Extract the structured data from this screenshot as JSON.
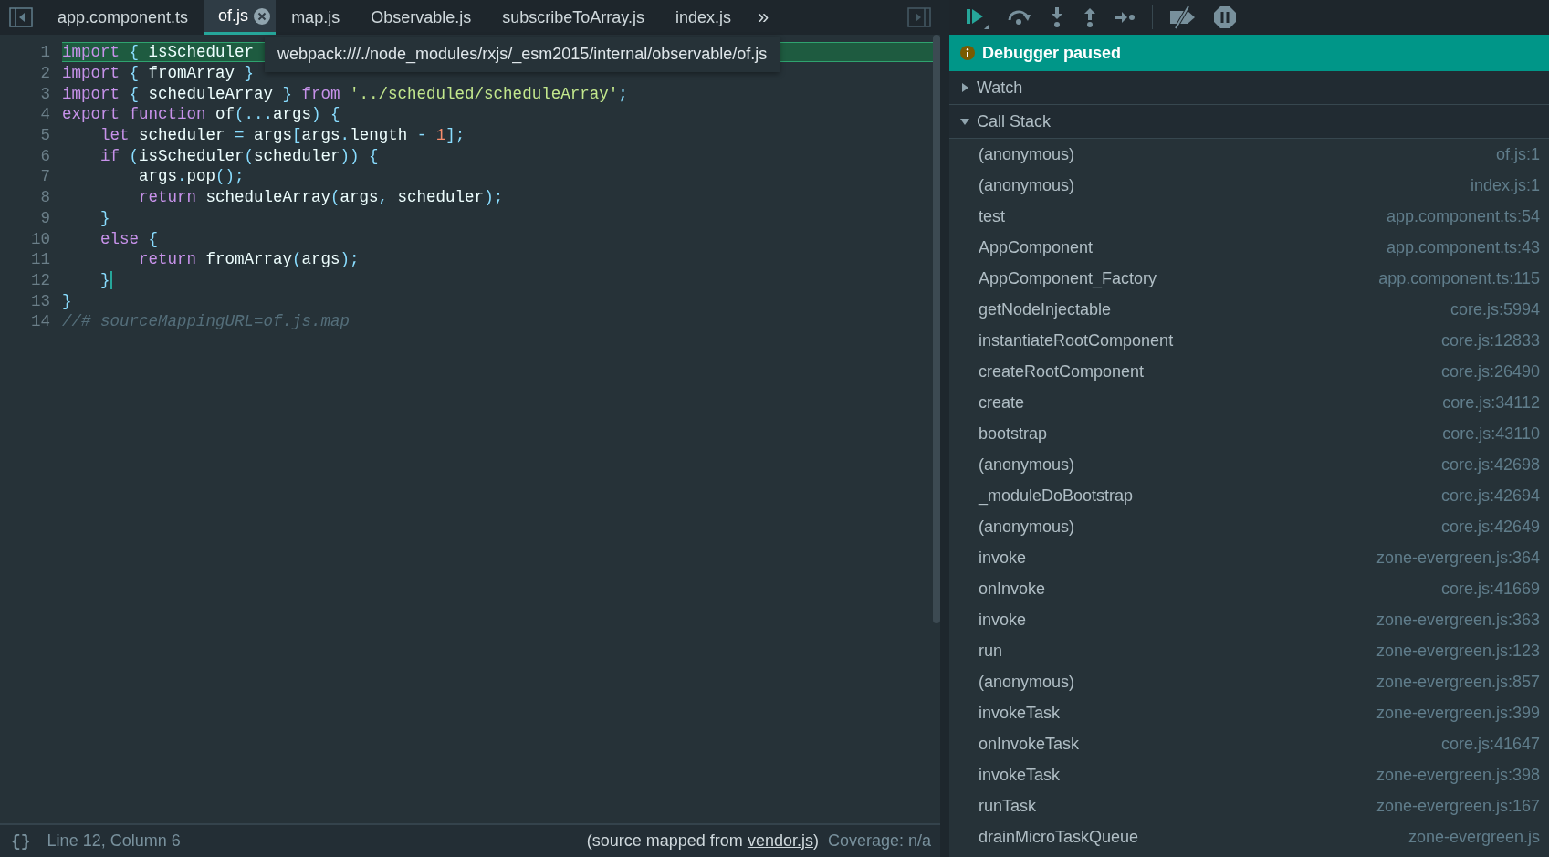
{
  "tabs": [
    {
      "label": "app.component.ts",
      "selected": false
    },
    {
      "label": "of.js",
      "selected": true
    },
    {
      "label": "map.js",
      "selected": false
    },
    {
      "label": "Observable.js",
      "selected": false
    },
    {
      "label": "subscribeToArray.js",
      "selected": false
    },
    {
      "label": "index.js",
      "selected": false
    }
  ],
  "more_tabs": "»",
  "editor": {
    "tooltip": "webpack:///./node_modules/rxjs/_esm2015/internal/observable/of.js",
    "lines": [
      {
        "number": "1",
        "highlighted": true,
        "tokens": [
          {
            "kind": "kw",
            "t": "import"
          },
          {
            "kind": "punc",
            "t": " { "
          },
          {
            "kind": "id",
            "t": "isScheduler"
          }
        ]
      },
      {
        "number": "2",
        "highlighted": false,
        "tokens": [
          {
            "kind": "kw",
            "t": "import"
          },
          {
            "kind": "punc",
            "t": " { "
          },
          {
            "kind": "id",
            "t": "fromArray"
          },
          {
            "kind": "punc",
            "t": " }"
          }
        ]
      },
      {
        "number": "3",
        "highlighted": false,
        "tokens": [
          {
            "kind": "kw",
            "t": "import"
          },
          {
            "kind": "punc",
            "t": " { "
          },
          {
            "kind": "id",
            "t": "scheduleArray"
          },
          {
            "kind": "punc",
            "t": " } "
          },
          {
            "kind": "kw",
            "t": "from"
          },
          {
            "kind": "str",
            "t": " '../scheduled/scheduleArray'"
          },
          {
            "kind": "punc",
            "t": ";"
          }
        ]
      },
      {
        "number": "4",
        "highlighted": false,
        "tokens": [
          {
            "kind": "kw",
            "t": "export function"
          },
          {
            "kind": "id",
            "t": " of"
          },
          {
            "kind": "punc",
            "t": "(..."
          },
          {
            "kind": "id",
            "t": "args"
          },
          {
            "kind": "punc",
            "t": ") {"
          }
        ]
      },
      {
        "number": "5",
        "highlighted": false,
        "tokens": [
          {
            "kind": "kw",
            "t": "    let"
          },
          {
            "kind": "id",
            "t": " scheduler "
          },
          {
            "kind": "punc",
            "t": "= "
          },
          {
            "kind": "id",
            "t": "args"
          },
          {
            "kind": "punc",
            "t": "["
          },
          {
            "kind": "id",
            "t": "args"
          },
          {
            "kind": "punc",
            "t": "."
          },
          {
            "kind": "id",
            "t": "length "
          },
          {
            "kind": "punc",
            "t": "- "
          },
          {
            "kind": "num",
            "t": "1"
          },
          {
            "kind": "punc",
            "t": "];"
          }
        ]
      },
      {
        "number": "6",
        "highlighted": false,
        "tokens": [
          {
            "kind": "kw",
            "t": "    if"
          },
          {
            "kind": "punc",
            "t": " ("
          },
          {
            "kind": "id",
            "t": "isScheduler"
          },
          {
            "kind": "punc",
            "t": "("
          },
          {
            "kind": "id",
            "t": "scheduler"
          },
          {
            "kind": "punc",
            "t": ")) {"
          }
        ]
      },
      {
        "number": "7",
        "highlighted": false,
        "tokens": [
          {
            "kind": "id",
            "t": "        args"
          },
          {
            "kind": "punc",
            "t": "."
          },
          {
            "kind": "id",
            "t": "pop"
          },
          {
            "kind": "punc",
            "t": "();"
          }
        ]
      },
      {
        "number": "8",
        "highlighted": false,
        "tokens": [
          {
            "kind": "kw",
            "t": "        return"
          },
          {
            "kind": "id",
            "t": " scheduleArray"
          },
          {
            "kind": "punc",
            "t": "("
          },
          {
            "kind": "id",
            "t": "args"
          },
          {
            "kind": "punc",
            "t": ", "
          },
          {
            "kind": "id",
            "t": "scheduler"
          },
          {
            "kind": "punc",
            "t": ");"
          }
        ]
      },
      {
        "number": "9",
        "highlighted": false,
        "tokens": [
          {
            "kind": "punc",
            "t": "    }"
          }
        ]
      },
      {
        "number": "10",
        "highlighted": false,
        "tokens": [
          {
            "kind": "kw",
            "t": "    else"
          },
          {
            "kind": "punc",
            "t": " {"
          }
        ]
      },
      {
        "number": "11",
        "highlighted": false,
        "tokens": [
          {
            "kind": "kw",
            "t": "        return"
          },
          {
            "kind": "id",
            "t": " fromArray"
          },
          {
            "kind": "punc",
            "t": "("
          },
          {
            "kind": "id",
            "t": "args"
          },
          {
            "kind": "punc",
            "t": ");"
          }
        ]
      },
      {
        "number": "12",
        "highlighted": false,
        "cursor": true,
        "tokens": [
          {
            "kind": "punc",
            "t": "    }"
          }
        ]
      },
      {
        "number": "13",
        "highlighted": false,
        "tokens": [
          {
            "kind": "punc",
            "t": "}"
          }
        ]
      },
      {
        "number": "14",
        "highlighted": false,
        "tokens": [
          {
            "kind": "comment",
            "t": "//# sourceMappingURL=of.js.map"
          }
        ]
      }
    ]
  },
  "status_bar": {
    "format_button": "{}",
    "position": "Line 12, Column 6",
    "source_prefix": "(source mapped from ",
    "source_link": "vendor.js",
    "source_suffix": ")",
    "coverage": "Coverage: n/a"
  },
  "debugger": {
    "banner": "Debugger paused",
    "sections": [
      {
        "label": "Watch",
        "expanded": false
      },
      {
        "label": "Call Stack",
        "expanded": true
      }
    ],
    "call_stack": [
      {
        "name": "(anonymous)",
        "location": "of.js:1"
      },
      {
        "name": "(anonymous)",
        "location": "index.js:1"
      },
      {
        "name": "test",
        "location": "app.component.ts:54"
      },
      {
        "name": "AppComponent",
        "location": "app.component.ts:43"
      },
      {
        "name": "AppComponent_Factory",
        "location": "app.component.ts:115"
      },
      {
        "name": "getNodeInjectable",
        "location": "core.js:5994"
      },
      {
        "name": "instantiateRootComponent",
        "location": "core.js:12833"
      },
      {
        "name": "createRootComponent",
        "location": "core.js:26490"
      },
      {
        "name": "create",
        "location": "core.js:34112"
      },
      {
        "name": "bootstrap",
        "location": "core.js:43110"
      },
      {
        "name": "(anonymous)",
        "location": "core.js:42698"
      },
      {
        "name": "_moduleDoBootstrap",
        "location": "core.js:42694"
      },
      {
        "name": "(anonymous)",
        "location": "core.js:42649"
      },
      {
        "name": "invoke",
        "location": "zone-evergreen.js:364"
      },
      {
        "name": "onInvoke",
        "location": "core.js:41669"
      },
      {
        "name": "invoke",
        "location": "zone-evergreen.js:363"
      },
      {
        "name": "run",
        "location": "zone-evergreen.js:123"
      },
      {
        "name": "(anonymous)",
        "location": "zone-evergreen.js:857"
      },
      {
        "name": "invokeTask",
        "location": "zone-evergreen.js:399"
      },
      {
        "name": "onInvokeTask",
        "location": "core.js:41647"
      },
      {
        "name": "invokeTask",
        "location": "zone-evergreen.js:398"
      },
      {
        "name": "runTask",
        "location": "zone-evergreen.js:167"
      },
      {
        "name": "drainMicroTaskQueue",
        "location": "zone-evergreen.js"
      }
    ]
  }
}
